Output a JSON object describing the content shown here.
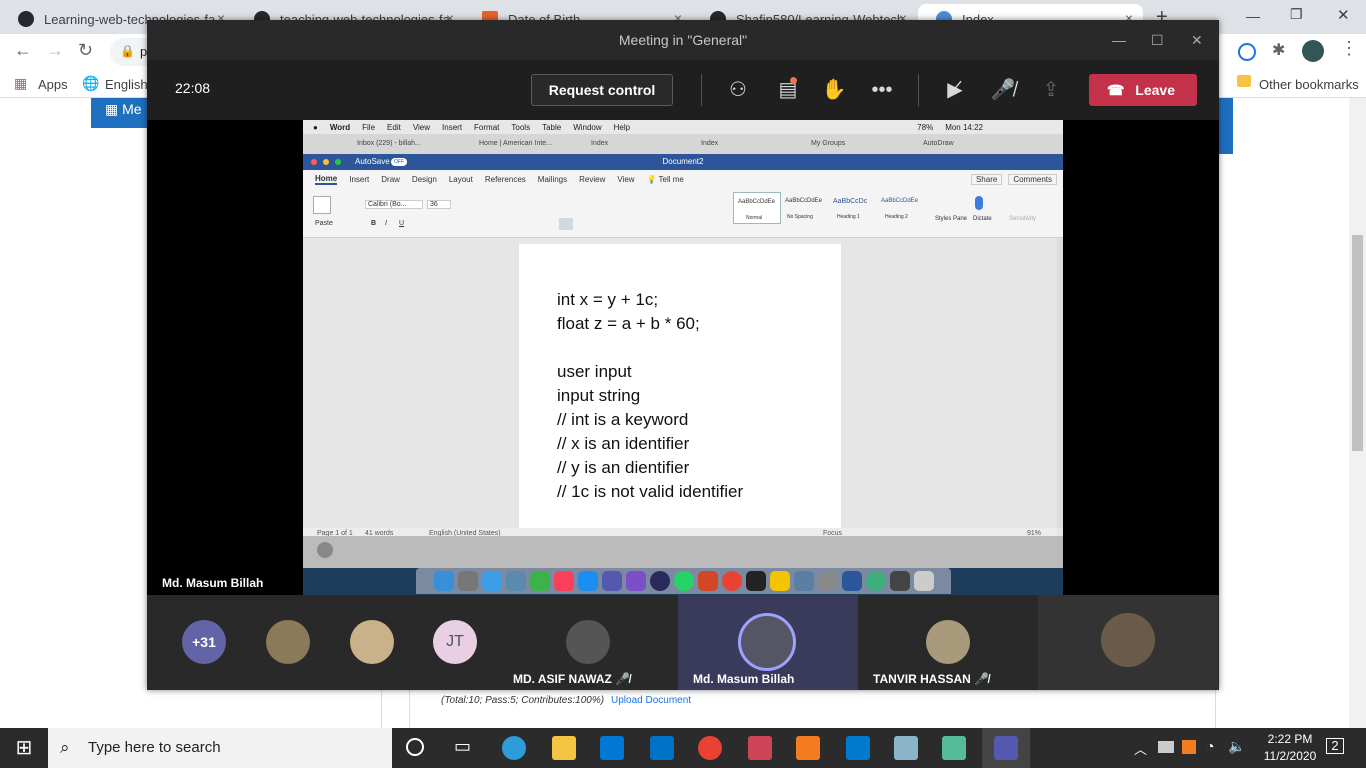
{
  "chrome": {
    "tabs": [
      {
        "label": "Learning-web-technologies-fa",
        "close": "×"
      },
      {
        "label": "teaching-web-technologies-fa",
        "close": "×"
      },
      {
        "label": "Date of Birth",
        "close": "×"
      },
      {
        "label": "Shafin580/Learning-Webtech-",
        "close": "×"
      },
      {
        "label": "Index",
        "close": "×"
      }
    ],
    "new_tab": "+",
    "address_prefix": "p",
    "bookmarks": {
      "apps": "Apps",
      "english": "English",
      "other": "Other bookmarks"
    },
    "window_controls": {
      "min": "—",
      "max": "❐",
      "close": "✕"
    }
  },
  "page": {
    "nav_label": "Me",
    "footer_text": "(Total:10; Pass:5; Contributes:100%)",
    "upload_link": "Upload Document"
  },
  "teams": {
    "title": "Meeting in \"General\"",
    "time": "22:08",
    "request_control": "Request control",
    "leave": "Leave",
    "presenter": "Md. Masum Billah",
    "participants": [
      {
        "label": "+31",
        "color": "#6264a7"
      },
      {
        "label": "",
        "color": "#8a7a5a"
      },
      {
        "label": "",
        "color": "#c9b28a"
      },
      {
        "label": "JT",
        "color": "#e8cfe3"
      },
      {
        "label": "MD. ASIF NAWAZ",
        "mic": "🎤̸"
      },
      {
        "label": "Md. Masum Billah"
      },
      {
        "label": "TANVIR HASSAN",
        "mic": "🎤̸"
      },
      {
        "label": ""
      }
    ]
  },
  "mac": {
    "menu": [
      "Word",
      "File",
      "Edit",
      "View",
      "Insert",
      "Format",
      "Tools",
      "Table",
      "Window",
      "Help"
    ],
    "battery": "78%",
    "clock": "Mon 14:22",
    "browser_tabs": [
      "Inbox (229) - billah...",
      "Home | American Inte...",
      "Index",
      "Index",
      "My Groups",
      "AutoDraw"
    ]
  },
  "word": {
    "autosave": "AutoSave",
    "autosave_state": "OFF",
    "title": "Document2",
    "ribbon_tabs": [
      "Home",
      "Insert",
      "Draw",
      "Design",
      "Layout",
      "References",
      "Mailings",
      "Review",
      "View"
    ],
    "tell_me": "Tell me",
    "share": "Share",
    "comments": "Comments",
    "paste": "Paste",
    "font": "Calibri (Bo...",
    "font_size": "36",
    "styles": [
      "Normal",
      "No Spacing",
      "Heading 1",
      "Heading 2"
    ],
    "style_preview": "AaBbCcDdEe",
    "styles_pane": "Styles Pane",
    "dictate": "Dictate",
    "sensitivity": "Sensitivity",
    "doc_lines": [
      "int x = y + 1c;",
      "float z = a + b * 60;",
      "",
      "user input",
      "input string",
      "// int is a keyword",
      "// x is an identifier",
      "// y is an dientifier",
      "// 1c is not valid identifier"
    ],
    "status": {
      "page": "Page 1 of 1",
      "words": "41 words",
      "lang": "English (United States)",
      "focus": "Focus",
      "zoom": "91%"
    }
  },
  "taskbar": {
    "search_placeholder": "Type here to search",
    "time": "2:22 PM",
    "date": "11/2/2020",
    "notifications": "2"
  }
}
